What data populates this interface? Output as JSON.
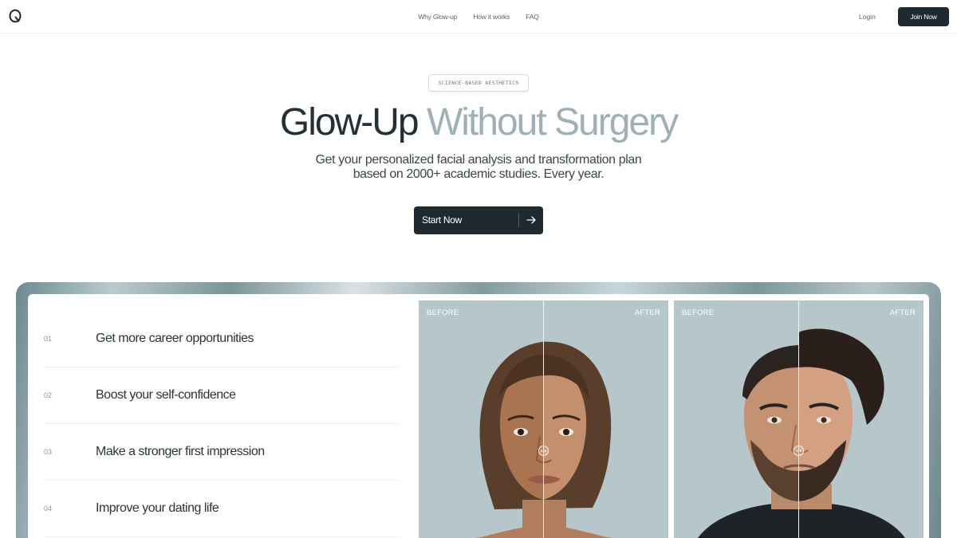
{
  "nav": {
    "logo_icon": "ring-logo-icon",
    "links": [
      "Why Glow-up",
      "How it works",
      "FAQ"
    ],
    "login_label": "Login",
    "join_label": "Join Now"
  },
  "hero": {
    "badge": "SCIENCE-BASED AESTHETICS",
    "headline_dark": "Glow-Up",
    "headline_light": "Without Surgery",
    "subline_1": "Get your personalized facial analysis and transformation plan",
    "subline_2": "based on 2000+ academic studies. Every year.",
    "cta_label": "Start Now",
    "cta_icon": "arrow-right-icon"
  },
  "benefits": [
    {
      "num": "01",
      "label": "Get more career opportunities"
    },
    {
      "num": "02",
      "label": "Boost your self-confidence"
    },
    {
      "num": "03",
      "label": "Make a stronger first impression"
    },
    {
      "num": "04",
      "label": "Improve your dating life"
    }
  ],
  "comparisons": [
    {
      "before_label": "BEFORE",
      "after_label": "AFTER"
    },
    {
      "before_label": "BEFORE",
      "after_label": "AFTER"
    }
  ],
  "colors": {
    "primary": "#1f2a30",
    "accent_light": "#9fb1b6",
    "photo_bg": "#b7c6cb"
  }
}
